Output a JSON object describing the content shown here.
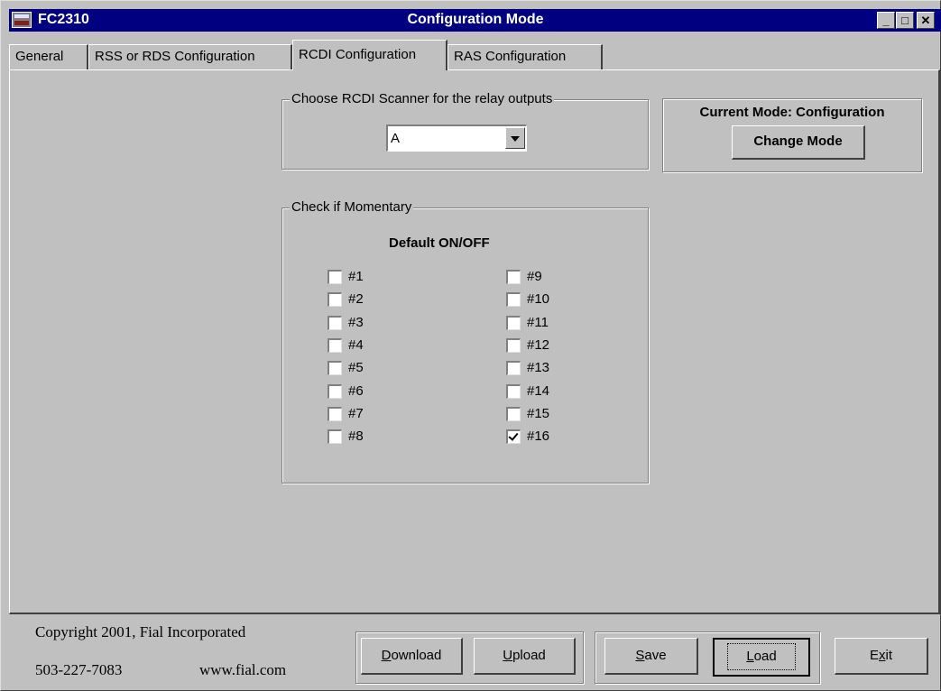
{
  "window": {
    "app_name": "FC2310",
    "title": "Configuration Mode",
    "controls": {
      "minimize": "_",
      "maximize": "□",
      "close": "✕"
    }
  },
  "tabs": [
    {
      "label": "General",
      "active": false
    },
    {
      "label": "RSS or RDS Configuration",
      "active": false
    },
    {
      "label": "RCDI Configuration",
      "active": true
    },
    {
      "label": "RAS Configuration",
      "active": false
    }
  ],
  "scanner_group": {
    "label": "Choose RCDI Scanner for the relay outputs",
    "selected": "A"
  },
  "mode_group": {
    "label": "Current Mode: Configuration",
    "button": "Change Mode"
  },
  "momentary_group": {
    "label": "Check if Momentary",
    "heading": "Default ON/OFF",
    "left": [
      {
        "label": "#1",
        "checked": false
      },
      {
        "label": "#2",
        "checked": false
      },
      {
        "label": "#3",
        "checked": false
      },
      {
        "label": "#4",
        "checked": false
      },
      {
        "label": "#5",
        "checked": false
      },
      {
        "label": "#6",
        "checked": false
      },
      {
        "label": "#7",
        "checked": false
      },
      {
        "label": "#8",
        "checked": false
      }
    ],
    "right": [
      {
        "label": "#9",
        "checked": false
      },
      {
        "label": "#10",
        "checked": false
      },
      {
        "label": "#11",
        "checked": false
      },
      {
        "label": "#12",
        "checked": false
      },
      {
        "label": "#13",
        "checked": false
      },
      {
        "label": "#14",
        "checked": false
      },
      {
        "label": "#15",
        "checked": false
      },
      {
        "label": "#16",
        "checked": true
      }
    ]
  },
  "footer": {
    "copyright": "Copyright 2001, Fial Incorporated",
    "phone": "503-227-7083",
    "website": "www.fial.com",
    "buttons": {
      "download_mnemonic": "D",
      "download_rest": "ownload",
      "upload_mnemonic": "U",
      "upload_rest": "pload",
      "save_mnemonic": "S",
      "save_rest": "ave",
      "load_mnemonic": "L",
      "load_rest": "oad",
      "exit_pre": "E",
      "exit_mnemonic": "x",
      "exit_rest": "it"
    }
  },
  "colors": {
    "face": "#c0c0c0",
    "titlebar": "#000080",
    "titletext": "#ffffff"
  }
}
